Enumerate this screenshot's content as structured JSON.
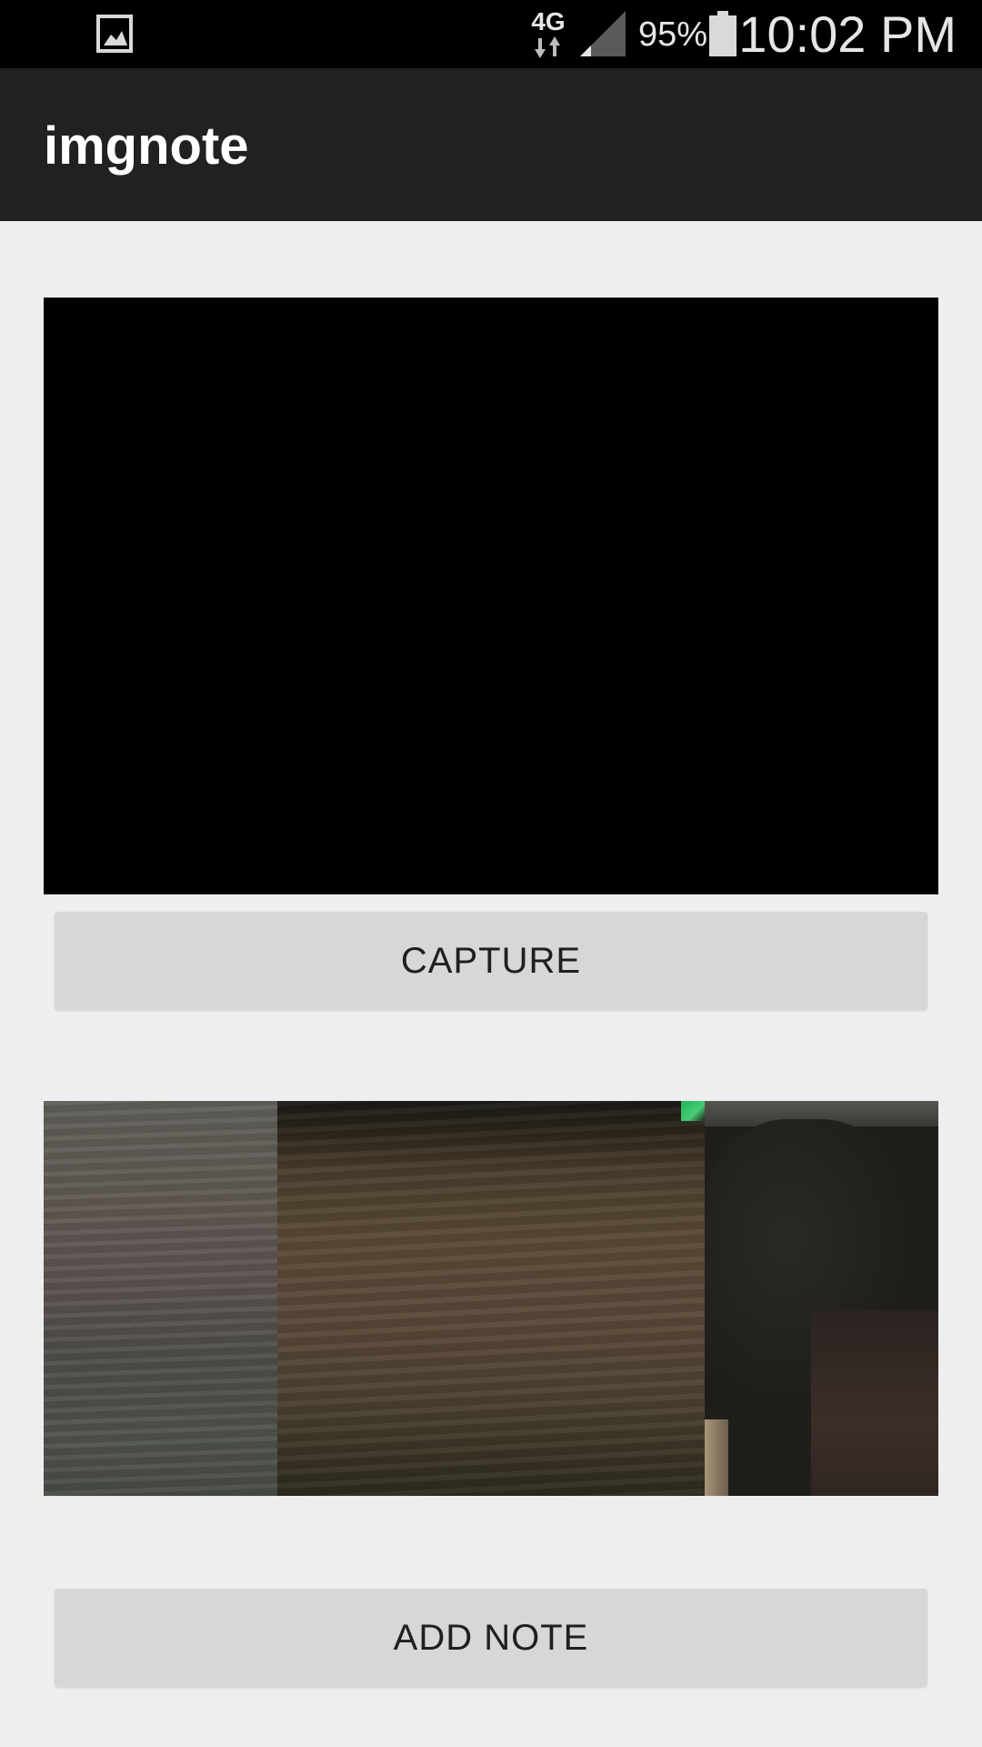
{
  "status_bar": {
    "gallery_icon": "image-icon",
    "network_label": "4G",
    "network_icon": "data-transfer-arrows-icon",
    "signal_icon": "cell-signal-icon",
    "battery_percent": "95%",
    "battery_icon": "battery-icon",
    "time": "10:02 PM"
  },
  "app_bar": {
    "title": "imgnote"
  },
  "camera": {
    "preview_label": "camera-preview"
  },
  "actions": {
    "capture_label": "CAPTURE",
    "add_note_label": "ADD NOTE"
  },
  "thumbnails": [
    {
      "name": "photo-thumbnail-1"
    },
    {
      "name": "photo-thumbnail-2"
    },
    {
      "name": "photo-thumbnail-3"
    }
  ],
  "colors": {
    "status_bar": "#000000",
    "app_bar": "#212121",
    "background": "#eeeeee",
    "button": "#d6d7d7",
    "button_text": "#1f1f1f"
  }
}
